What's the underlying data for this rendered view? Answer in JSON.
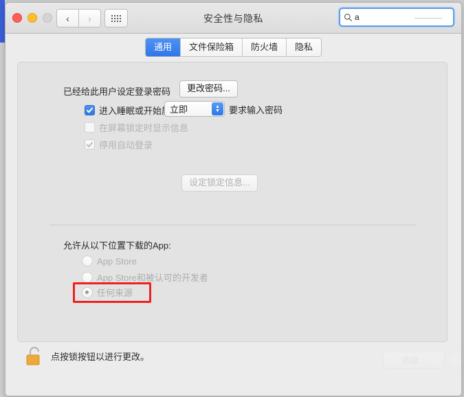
{
  "window": {
    "title": "安全性与隐私",
    "traffic_lights": [
      "close",
      "minimize",
      "zoom"
    ],
    "nav_back": "‹",
    "nav_forward": "›",
    "show_all_icon": "grid-icon"
  },
  "search": {
    "value": "a",
    "placeholder": "",
    "icon": "search-icon",
    "clear_icon": "clear-circle-icon"
  },
  "tabs": [
    {
      "label": "通用",
      "active": true
    },
    {
      "label": "文件保险箱",
      "active": false
    },
    {
      "label": "防火墙",
      "active": false
    },
    {
      "label": "隐私",
      "active": false
    }
  ],
  "general": {
    "password_status": "已经给此用户设定登录密码",
    "change_password_button": "更改密码...",
    "require_password": {
      "checked": true,
      "enabled": true,
      "label_before": "进入睡眠或开始屏幕保护程序",
      "delay_value": "立即",
      "label_after": "要求输入密码"
    },
    "show_message": {
      "checked": false,
      "enabled": false,
      "label": "在屏幕锁定时显示信息",
      "button": "设定锁定信息..."
    },
    "disable_auto_login": {
      "checked": true,
      "enabled": false,
      "label": "停用自动登录"
    },
    "download_heading": "允许从以下位置下载的App:",
    "download_options": [
      {
        "label": "App Store",
        "selected": false
      },
      {
        "label": "App Store和被认可的开发者",
        "selected": false
      },
      {
        "label": "任何来源",
        "selected": true,
        "highlighted": true
      }
    ]
  },
  "footer": {
    "lock_icon": "open-lock-icon",
    "lock_text": "点按锁按钮以进行更改。",
    "advanced_button": "高级...",
    "help_button": "?"
  },
  "annotation": {
    "color": "#f02020",
    "target": "任何来源"
  }
}
